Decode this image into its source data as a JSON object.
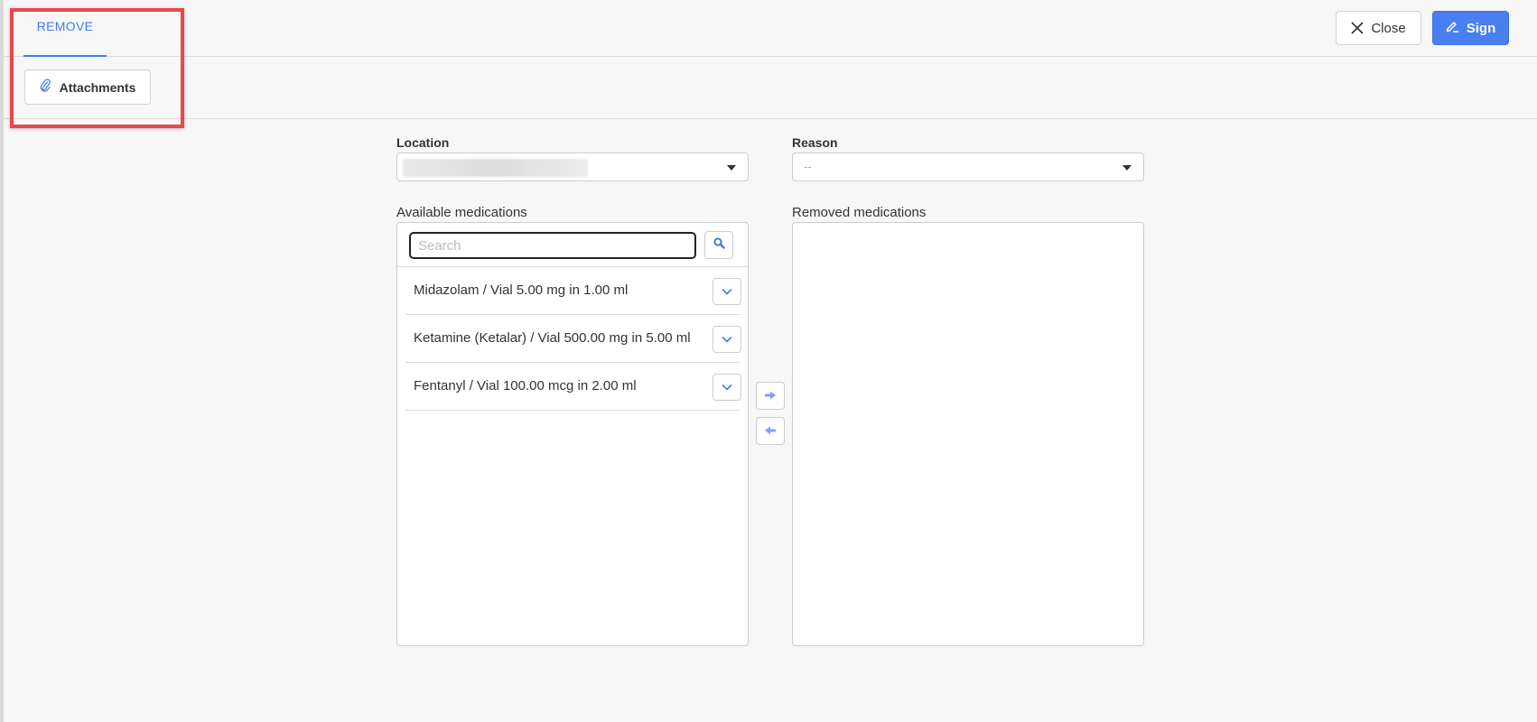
{
  "header": {
    "tab_label": "REMOVE",
    "close_label": "Close",
    "sign_label": "Sign"
  },
  "toolbar": {
    "attachments_label": "Attachments"
  },
  "form": {
    "location_label": "Location",
    "location_value": "",
    "reason_label": "Reason",
    "reason_value": "--"
  },
  "available": {
    "title": "Available medications",
    "search_placeholder": "Search",
    "items": [
      {
        "name": "Midazolam / Vial 5.00 mg in 1.00 ml"
      },
      {
        "name": "Ketamine (Ketalar) / Vial 500.00 mg in 5.00 ml"
      },
      {
        "name": "Fentanyl / Vial 100.00 mcg in 2.00 ml"
      }
    ]
  },
  "removed": {
    "title": "Removed medications",
    "items": []
  },
  "colors": {
    "accent": "#4a7ff2",
    "highlight": "#e8474b"
  },
  "icons": {
    "close": "close-icon",
    "sign": "pen-icon",
    "attach": "paperclip-icon",
    "search": "search-icon",
    "expand": "chevron-down-icon",
    "move_right": "arrow-right-icon",
    "move_left": "arrow-left-icon"
  }
}
